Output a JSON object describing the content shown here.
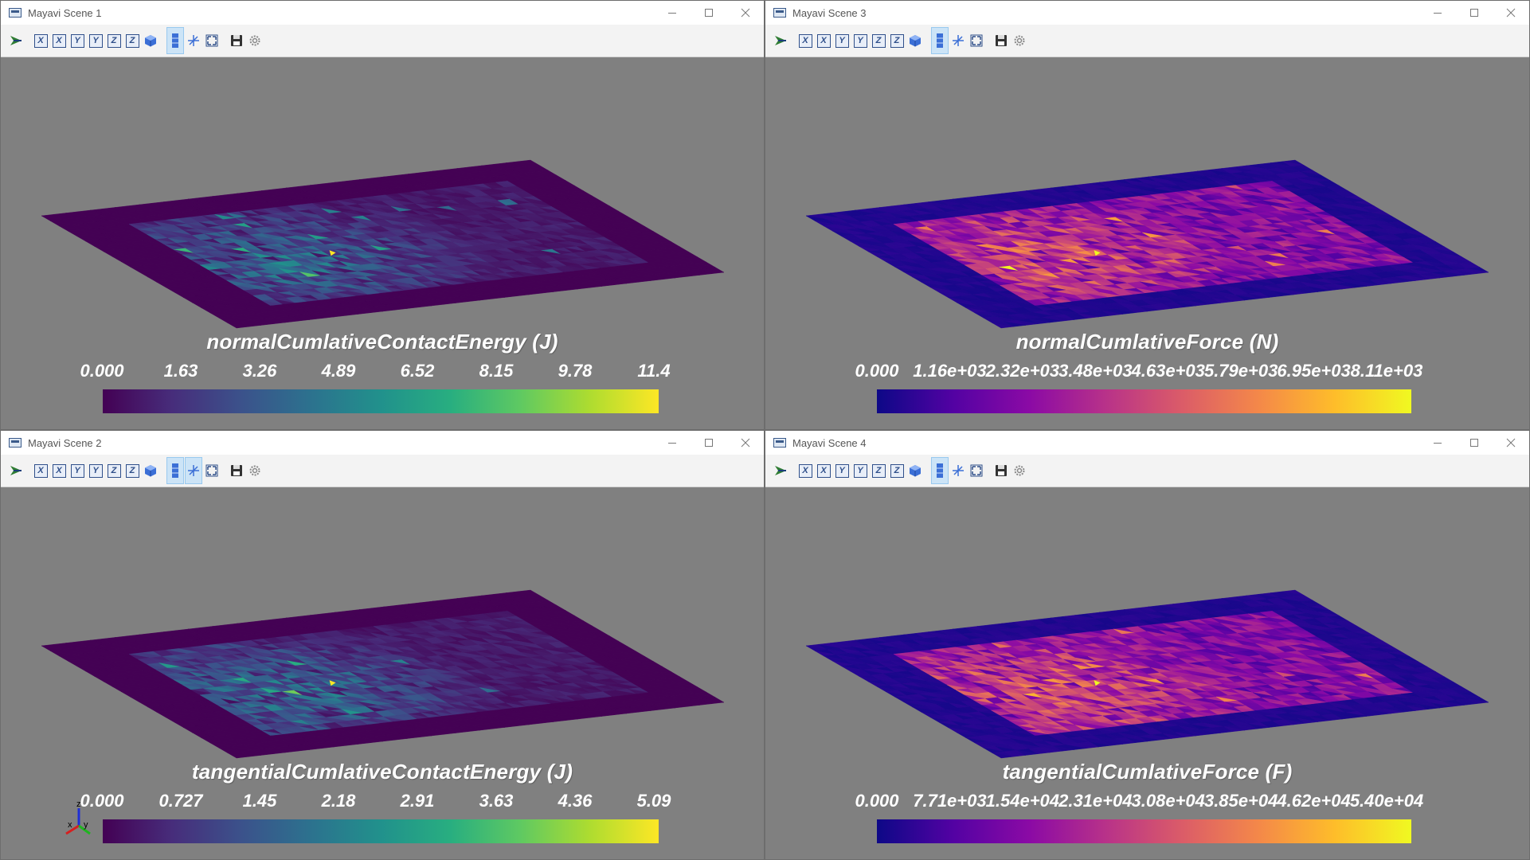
{
  "windows": [
    {
      "id": "w1",
      "title": "Mayavi Scene 1",
      "colormap": "viridis",
      "colorbar": {
        "title": "normalCumlativeContactEnergy (J)",
        "ticks": [
          "0.000",
          "1.63",
          "3.26",
          "4.89",
          "6.52",
          "8.15",
          "9.78",
          "11.4"
        ]
      }
    },
    {
      "id": "w3",
      "title": "Mayavi Scene 3",
      "colormap": "plasma",
      "colorbar": {
        "title": "normalCumlativeForce (N)",
        "ticks": [
          "0.000",
          "1.16e+03",
          "2.32e+03",
          "3.48e+03",
          "4.63e+03",
          "5.79e+03",
          "6.95e+03",
          "8.11e+03"
        ]
      }
    },
    {
      "id": "w2",
      "title": "Mayavi Scene 2",
      "colormap": "viridis",
      "colorbar": {
        "title": "tangentialCumlativeContactEnergy (J)",
        "ticks": [
          "0.000",
          "0.727",
          "1.45",
          "2.18",
          "2.91",
          "3.63",
          "4.36",
          "5.09"
        ]
      },
      "axes_labels": {
        "x": "x",
        "y": "y",
        "z": "z"
      }
    },
    {
      "id": "w4",
      "title": "Mayavi Scene 4",
      "colormap": "plasma",
      "colorbar": {
        "title": "tangentialCumlativeForce (F)",
        "ticks": [
          "0.000",
          "7.71e+03",
          "1.54e+04",
          "2.31e+04",
          "3.08e+04",
          "3.85e+04",
          "4.62e+04",
          "5.40e+04"
        ]
      }
    }
  ],
  "toolbar_icons": [
    "mayavi-logo-icon",
    "view-x-pos-icon",
    "view-x-neg-icon",
    "view-y-pos-icon",
    "view-y-neg-icon",
    "view-z-pos-icon",
    "view-z-neg-icon",
    "isometric-icon",
    "parallel-projection-icon",
    "axes-toggle-icon",
    "fullscreen-icon",
    "save-icon",
    "configure-icon"
  ],
  "colors": {
    "viewport_bg": "#808080",
    "viridis_low": "#440154",
    "viridis_high": "#fde725",
    "plasma_low": "#0d0887",
    "plasma_high": "#f0f921"
  }
}
